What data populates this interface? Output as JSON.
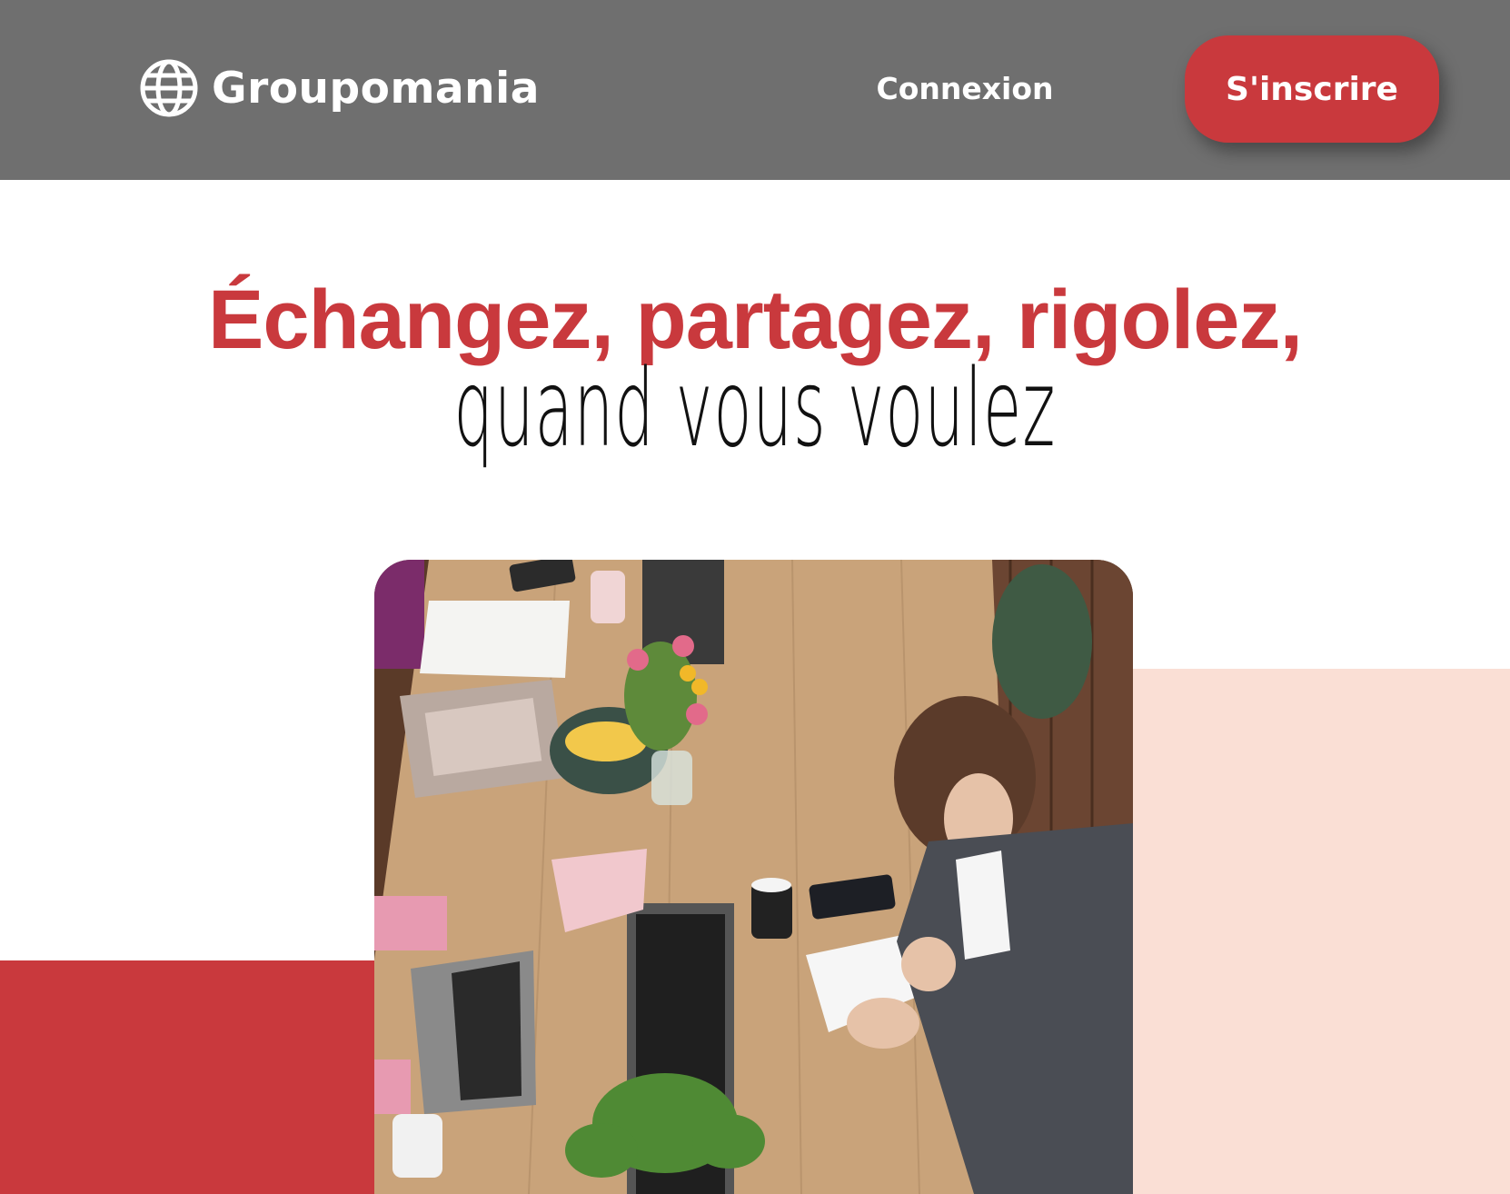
{
  "header": {
    "brand_name": "Groupomania",
    "brand_icon": "globe-icon",
    "login_label": "Connexion",
    "signup_label": "S'inscrire"
  },
  "hero": {
    "line1": "Échangez, partagez, rigolez,",
    "line2": "quand vous voulez"
  },
  "photo": {
    "description_icon": "office-table-photo"
  },
  "colors": {
    "header_bg": "#6f6f6f",
    "accent_red": "#c9393d",
    "accent_pink": "#fadfd5",
    "text_dark": "#111111"
  }
}
